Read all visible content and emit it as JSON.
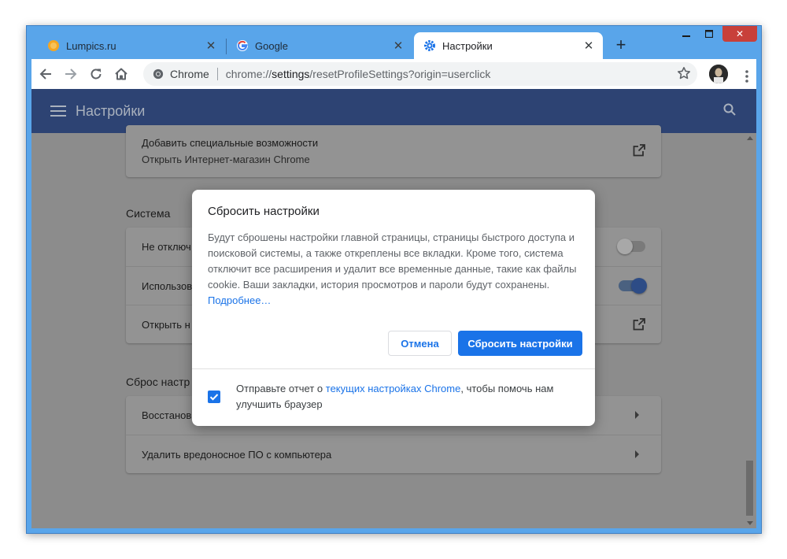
{
  "tabs": [
    {
      "title": "Lumpics.ru",
      "favicon": "lumpics-icon"
    },
    {
      "title": "Google",
      "favicon": "google-icon"
    },
    {
      "title": "Настройки",
      "favicon": "gear-icon"
    }
  ],
  "address_bar": {
    "chip_label": "Chrome",
    "url_prefix": "chrome://",
    "url_host": "settings",
    "url_path": "/resetProfileSettings?origin=userclick"
  },
  "header": {
    "title": "Настройки"
  },
  "accessibility_card": {
    "title": "Добавить специальные возможности",
    "subtitle": "Открыть Интернет-магазин Chrome"
  },
  "system_section": {
    "title": "Система",
    "rows": [
      {
        "label": "Не отключ",
        "toggle": false
      },
      {
        "label": "Использов",
        "toggle": true
      },
      {
        "label": "Открыть н"
      }
    ]
  },
  "reset_section": {
    "title": "Сброс настр",
    "rows": [
      {
        "label": "Восстанов"
      },
      {
        "label": "Удалить вредоносное ПО с компьютера"
      }
    ]
  },
  "dialog": {
    "title": "Сбросить настройки",
    "body": "Будут сброшены настройки главной страницы, страницы быстрого доступа и поисковой системы, а также откреплены все вкладки. Кроме того, система отключит все расширения и удалит все временные данные, такие как файлы cookie. Ваши закладки, история просмотров и пароли будут сохранены.",
    "learn_more": "Подробнее…",
    "cancel_label": "Отмена",
    "reset_label": "Сбросить настройки",
    "footer_prefix": "Отправьте отчет о ",
    "footer_link": "текущих настройках Chrome",
    "footer_suffix": ", чтобы помочь нам улучшить браузер",
    "checkbox_checked": true
  },
  "colors": {
    "accent": "#1a73e8",
    "header_bg": "#2d4373",
    "window_frame": "#59a5ea"
  }
}
